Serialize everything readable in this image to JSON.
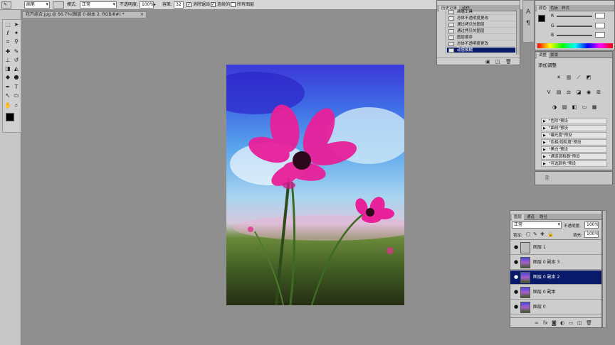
{
  "options_bar": {
    "preset": "画笔",
    "mode_label": "模式:",
    "mode_value": "正常",
    "opacity_label": "不透明度:",
    "opacity_value": "100%",
    "tolerance_label": "容差:",
    "tolerance_value": "32",
    "antialias_label": "消除锯齿",
    "contiguous_label": "连续的",
    "all_layers_label": "所有图层"
  },
  "document_tab": {
    "title": "花卉组合.jpg @ 66.7%(图层 0 副本 2, RGB/8#) *",
    "close": "×"
  },
  "history_panel": {
    "tabs": [
      "历史记录",
      "动作"
    ],
    "items": [
      "画笔工具",
      "总体不透明度更改",
      "通过拷贝的图层",
      "通过拷贝的图层",
      "图层顺序",
      "总体不透明度更改",
      "动感模糊"
    ],
    "selected_index": 6
  },
  "color_panel": {
    "tabs": [
      "颜色",
      "色板",
      "样式"
    ],
    "channels": [
      {
        "label": "R",
        "value": "",
        "color": "#d01818"
      },
      {
        "label": "G",
        "value": "",
        "color": "#18a818"
      },
      {
        "label": "B",
        "value": "",
        "color": "#2020d8"
      }
    ],
    "foreground_color": "#000000",
    "background_color": "#ffffff"
  },
  "adjustments_panel": {
    "tabs": [
      "调整",
      "蒙版"
    ],
    "title": "添加调整",
    "presets": [
      "\"色阶\"预设",
      "\"曲线\"预设",
      "\"曝光度\"预设",
      "\"色相/饱和度\"预设",
      "\"黑白\"预设",
      "\"通道混和器\"预设",
      "\"可选颜色\"预设"
    ]
  },
  "layers_panel": {
    "tabs": [
      "图层",
      "通道",
      "路径"
    ],
    "blend_mode": "正常",
    "opacity_label": "不透明度:",
    "opacity_value": "100%",
    "lock_label": "锁定:",
    "fill_label": "填充:",
    "fill_value": "100%",
    "layers": [
      {
        "name": "图层 1",
        "selected": false
      },
      {
        "name": "图层 0 副本 3",
        "selected": false
      },
      {
        "name": "图层 0 副本 2",
        "selected": true
      },
      {
        "name": "图层 0 副本",
        "selected": false
      },
      {
        "name": "图层 0",
        "selected": false
      }
    ]
  },
  "accent_colors": {
    "selection": "#0a1a6a",
    "flower": "#e8209a"
  }
}
